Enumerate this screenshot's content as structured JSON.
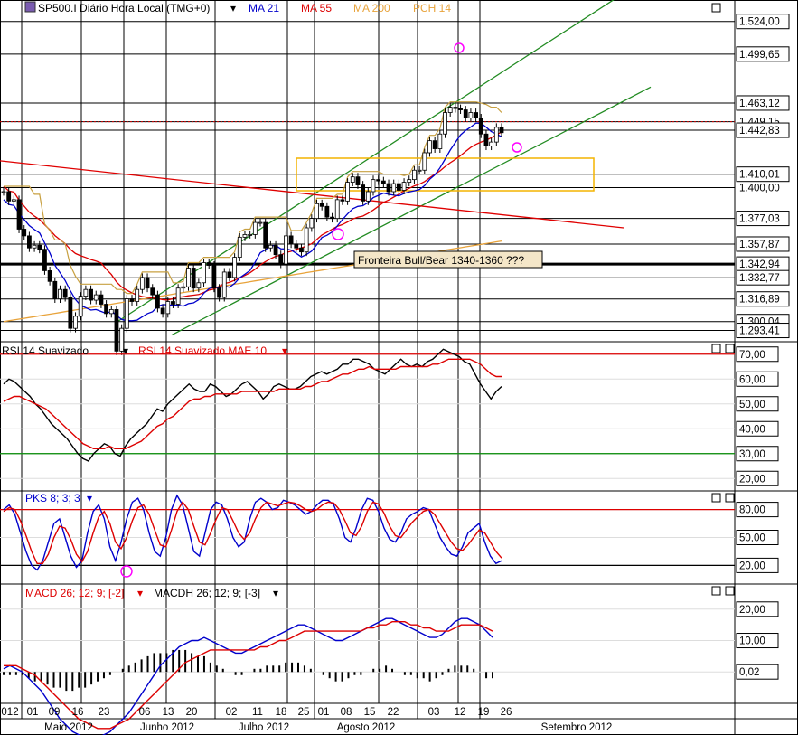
{
  "header": {
    "symbol_title": "SP500.I Diário Hora Local (TMG+0)",
    "indicators": [
      {
        "label": "MA 21",
        "color": "#0000cc"
      },
      {
        "label": "MA 55",
        "color": "#dd0000"
      },
      {
        "label": "MA 200",
        "color": "#e8a33b"
      },
      {
        "label": "PCH 14",
        "color": "#e8a33b"
      }
    ]
  },
  "colors": {
    "price": "#000000",
    "ma21": "#0000cc",
    "ma55": "#dd0000",
    "ma200": "#e8a33b",
    "pch": "#c8a040",
    "channel": "#228b22",
    "trend": "#e00000",
    "box": "#f4b400",
    "marker": "#ff00ff",
    "grid": "#000000"
  },
  "chart_data": [
    {
      "id": "price",
      "type": "candlestick",
      "title": "SP500.I Diário Hora Local (TMG+0)",
      "y_ticks": [
        "1.524,00",
        "1.499,65",
        "1.463,12",
        "1.449,15",
        "1.442,83",
        "1.410,01",
        "1.400,00",
        "1.377,03",
        "1.357,87",
        "1.342,94",
        "1.332,77",
        "1.316,89",
        "1.300,04",
        "1.293,41"
      ],
      "ylim": [
        1285,
        1540
      ],
      "annotation": "Fronteira Bull/Bear 1340-1360 ???",
      "series_close": [
        1397,
        1390,
        1391,
        1369,
        1364,
        1355,
        1357,
        1354,
        1338,
        1330,
        1317,
        1324,
        1318,
        1295,
        1304,
        1319,
        1324,
        1316,
        1320,
        1313,
        1306,
        1309,
        1278,
        1295,
        1317,
        1315,
        1324,
        1333,
        1325,
        1320,
        1310,
        1306,
        1315,
        1313,
        1325,
        1326,
        1340,
        1325,
        1329,
        1344,
        1342,
        1325,
        1318,
        1337,
        1333,
        1348,
        1363,
        1365,
        1365,
        1374,
        1374,
        1355,
        1357,
        1350,
        1343,
        1364,
        1358,
        1355,
        1352,
        1370,
        1377,
        1388,
        1386,
        1378,
        1377,
        1391,
        1390,
        1404,
        1408,
        1402,
        1390,
        1397,
        1406,
        1405,
        1403,
        1397,
        1403,
        1398,
        1404,
        1406,
        1413,
        1413,
        1426,
        1435,
        1429,
        1440,
        1456,
        1460,
        1459,
        1458,
        1452,
        1456,
        1452,
        1440,
        1431,
        1434,
        1445,
        1441
      ]
    },
    {
      "id": "rsi",
      "type": "line",
      "title": "RSI 14 Suavizado",
      "legend": [
        {
          "name": "RSI 14 Suavizado",
          "color": "#000000"
        },
        {
          "name": "RSI 14 Suavizado MAE 10",
          "color": "#dd0000"
        }
      ],
      "y_ticks": [
        "70,00",
        "60,00",
        "50,00",
        "40,00",
        "30,00",
        "20,00"
      ],
      "ylim": [
        15,
        75
      ],
      "hlines": [
        70,
        30
      ],
      "series": [
        {
          "name": "RSI 14 Suavizado",
          "values": [
            58,
            60,
            59,
            57,
            55,
            53,
            50,
            48,
            45,
            42,
            40,
            38,
            36,
            33,
            30,
            28,
            27,
            30,
            32,
            34,
            33,
            30,
            29,
            33,
            36,
            38,
            40,
            42,
            45,
            48,
            47,
            50,
            52,
            54,
            56,
            58,
            56,
            55,
            55,
            58,
            57,
            55,
            53,
            54,
            56,
            58,
            59,
            57,
            55,
            52,
            54,
            57,
            58,
            57,
            56,
            56,
            57,
            59,
            61,
            62,
            63,
            62,
            63,
            64,
            66,
            66,
            68,
            68,
            67,
            66,
            64,
            63,
            62,
            64,
            66,
            68,
            66,
            65,
            66,
            65,
            67,
            68,
            70,
            72,
            71,
            70,
            69,
            67,
            66,
            62,
            58,
            55,
            52,
            55,
            57
          ]
        },
        {
          "name": "RSI 14 Suavizado MAE 10",
          "values": [
            51,
            52,
            53,
            53,
            52,
            51,
            50,
            49,
            48,
            46,
            44,
            42,
            40,
            38,
            36,
            34,
            33,
            32,
            32,
            32,
            33,
            32,
            32,
            32,
            33,
            34,
            35,
            37,
            39,
            41,
            42,
            44,
            45,
            47,
            49,
            51,
            52,
            52,
            53,
            53,
            54,
            54,
            54,
            54,
            54,
            55,
            55,
            55,
            55,
            55,
            55,
            55,
            56,
            56,
            56,
            56,
            56,
            57,
            57,
            58,
            59,
            59,
            60,
            61,
            62,
            62,
            63,
            64,
            64,
            65,
            64,
            64,
            64,
            64,
            64,
            65,
            65,
            65,
            65,
            65,
            65,
            66,
            66,
            67,
            68,
            68,
            68,
            68,
            68,
            67,
            66,
            64,
            62,
            61,
            61
          ]
        }
      ]
    },
    {
      "id": "pks",
      "type": "line",
      "title": "PKS 8; 3; 3",
      "y_ticks": [
        "80,00",
        "50,00",
        "20,00"
      ],
      "ylim": [
        0,
        100
      ],
      "hlines": [
        80,
        20
      ],
      "series": [
        {
          "name": "PKS 8; 3; 3 %K",
          "values": [
            80,
            85,
            75,
            55,
            35,
            20,
            15,
            25,
            45,
            65,
            70,
            50,
            30,
            18,
            25,
            55,
            78,
            85,
            70,
            40,
            25,
            45,
            70,
            88,
            92,
            80,
            55,
            35,
            30,
            50,
            80,
            95,
            85,
            60,
            35,
            30,
            55,
            80,
            88,
            85,
            70,
            50,
            40,
            45,
            70,
            88,
            92,
            88,
            80,
            82,
            90,
            88,
            85,
            80,
            75,
            78,
            85,
            90,
            90,
            85,
            70,
            50,
            45,
            60,
            80,
            92,
            90,
            78,
            60,
            48,
            45,
            55,
            70,
            75,
            78,
            82,
            80,
            65,
            50,
            40,
            32,
            30,
            40,
            55,
            60,
            65,
            45,
            30,
            22,
            25
          ]
        },
        {
          "name": "PKS 8; 3; 3 %D",
          "values": [
            78,
            82,
            80,
            68,
            52,
            35,
            22,
            22,
            32,
            50,
            62,
            60,
            48,
            32,
            24,
            35,
            55,
            72,
            78,
            65,
            45,
            38,
            50,
            68,
            82,
            85,
            75,
            58,
            42,
            40,
            58,
            78,
            88,
            80,
            62,
            45,
            42,
            55,
            70,
            82,
            80,
            68,
            55,
            48,
            55,
            70,
            82,
            88,
            86,
            84,
            86,
            88,
            87,
            84,
            80,
            78,
            80,
            85,
            88,
            87,
            80,
            68,
            55,
            52,
            62,
            78,
            88,
            86,
            76,
            62,
            52,
            50,
            58,
            66,
            72,
            78,
            80,
            75,
            65,
            55,
            45,
            38,
            36,
            42,
            50,
            58,
            55,
            45,
            35,
            28
          ]
        }
      ]
    },
    {
      "id": "macd",
      "type": "line",
      "title": "MACD 26; 12; 9; [-2]",
      "legend": [
        {
          "name": "MACD 26; 12; 9; [-2]",
          "color": "#dd0000"
        },
        {
          "name": "MACDH 26; 12; 9; [-3]",
          "color": "#000000"
        }
      ],
      "y_ticks": [
        "20,00",
        "10,00",
        "0,02"
      ],
      "ylim": [
        -10,
        28
      ],
      "series": [
        {
          "name": "MACD line",
          "values": [
            1,
            2,
            1,
            0,
            -2,
            -4,
            -6,
            -9,
            -12,
            -15,
            -17,
            -19,
            -20,
            -21,
            -22,
            -21,
            -20,
            -19,
            -17,
            -15,
            -13,
            -10,
            -7,
            -4,
            -1,
            2,
            4,
            6,
            8,
            9,
            10,
            10,
            11,
            10,
            9,
            8,
            7,
            6,
            6,
            7,
            8,
            9,
            10,
            11,
            12,
            13,
            14,
            15,
            15,
            14,
            13,
            12,
            11,
            10,
            10,
            11,
            12,
            13,
            14,
            15,
            16,
            17,
            17,
            16,
            15,
            14,
            13,
            12,
            11,
            11,
            12,
            14,
            16,
            17,
            17,
            16,
            15,
            13,
            11
          ]
        },
        {
          "name": "Signal line",
          "values": [
            2,
            2,
            2,
            1,
            0,
            -1,
            -3,
            -5,
            -7,
            -9,
            -11,
            -13,
            -15,
            -16,
            -17,
            -18,
            -18,
            -18,
            -17,
            -16,
            -15,
            -13,
            -11,
            -9,
            -7,
            -5,
            -3,
            -1,
            1,
            3,
            4,
            5,
            6,
            7,
            7,
            7,
            7,
            7,
            7,
            7,
            7,
            8,
            8,
            9,
            10,
            10,
            11,
            12,
            13,
            13,
            13,
            13,
            13,
            13,
            13,
            13,
            13,
            13,
            14,
            14,
            15,
            15,
            16,
            16,
            16,
            15,
            15,
            14,
            14,
            13,
            13,
            13,
            14,
            15,
            15,
            15,
            15,
            14,
            13
          ]
        },
        {
          "name": "MACDH",
          "values": [
            -1,
            -1,
            -1,
            -1,
            -2,
            -3,
            -3,
            -4,
            -5,
            -5,
            -6,
            -6,
            -5,
            -5,
            -4,
            -3,
            -2,
            -1,
            0,
            1,
            2,
            3,
            4,
            5,
            6,
            6,
            6,
            7,
            7,
            7,
            6,
            5,
            5,
            3,
            2,
            1,
            0,
            -1,
            -1,
            0,
            1,
            1,
            2,
            2,
            2,
            3,
            3,
            3,
            2,
            1,
            0,
            -1,
            -2,
            -3,
            -3,
            -2,
            -1,
            -1,
            0,
            1,
            1,
            2,
            1,
            0,
            -1,
            -1,
            -2,
            -2,
            -3,
            -2,
            -1,
            1,
            2,
            2,
            2,
            1,
            0,
            -2,
            -2
          ]
        }
      ]
    }
  ],
  "xaxis": {
    "day_labels": [
      "012",
      "01",
      "09",
      "16",
      "23",
      "06",
      "13",
      "20",
      "02",
      "11",
      "18",
      "25",
      "01",
      "08",
      "15",
      "22",
      "03",
      "12",
      "19",
      "26"
    ],
    "month_labels": [
      "Maio 2012",
      "Junho 2012",
      "Julho 2012",
      "Agosto 2012",
      "Setembro 2012"
    ]
  }
}
